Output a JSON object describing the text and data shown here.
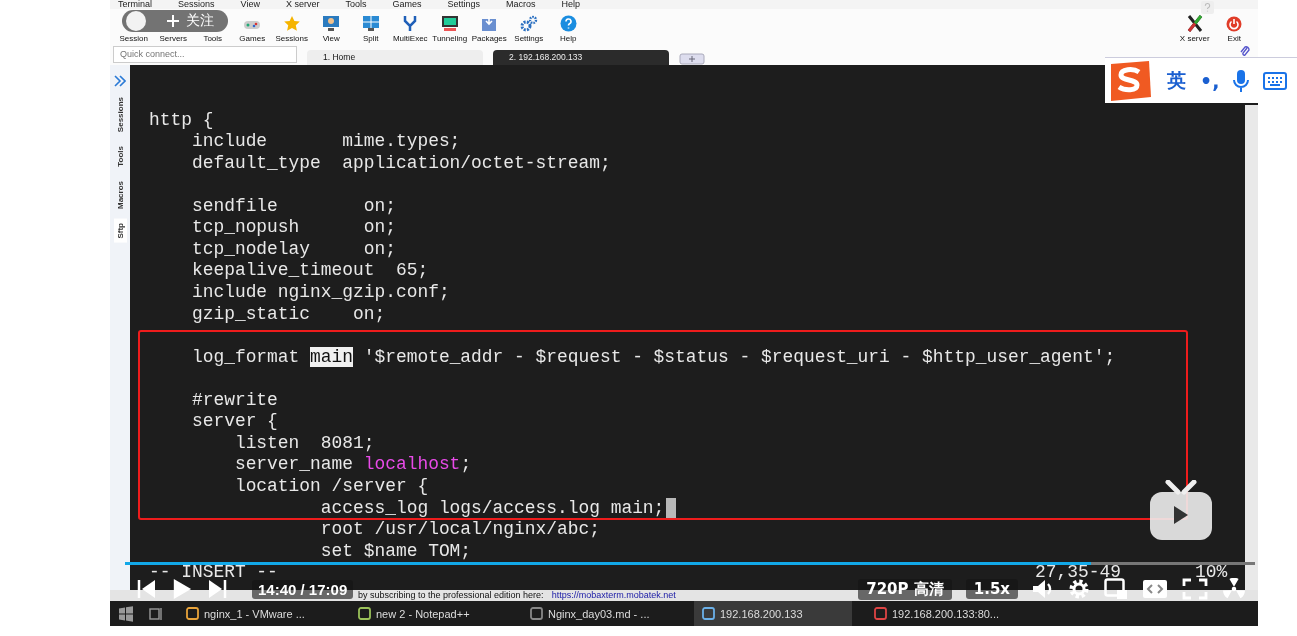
{
  "menu_bar": [
    "Terminal",
    "Sessions",
    "View",
    "X server",
    "Tools",
    "Games",
    "Settings",
    "Macros",
    "Help"
  ],
  "toolbar": [
    {
      "label": "Session"
    },
    {
      "label": "Servers"
    },
    {
      "label": "Tools"
    },
    {
      "label": "Games"
    },
    {
      "label": "Sessions"
    },
    {
      "label": "View"
    },
    {
      "label": "Split"
    },
    {
      "label": "MultiExec"
    },
    {
      "label": "Tunneling"
    },
    {
      "label": "Packages"
    },
    {
      "label": "Settings"
    },
    {
      "label": "Help"
    }
  ],
  "toolbar_right": [
    {
      "label": "X server"
    },
    {
      "label": "Exit"
    }
  ],
  "follow_button": {
    "label": "关注"
  },
  "quick_connect": {
    "placeholder": "Quick connect..."
  },
  "tabs": [
    {
      "label": "1. Home",
      "selected": false
    },
    {
      "label": "2. 192.168.200.133",
      "selected": true
    }
  ],
  "sidebar_tabs": [
    {
      "label": "Sessions",
      "selected": false
    },
    {
      "label": "Tools",
      "selected": false
    },
    {
      "label": "Macros",
      "selected": false
    },
    {
      "label": "Sftp",
      "selected": true
    }
  ],
  "ime_bar": {
    "mode": "英",
    "punctuation": "•,"
  },
  "terminal": {
    "lines": [
      {
        "kind": "code",
        "segments": [
          {
            "kind": "plain",
            "text": "http {"
          }
        ]
      },
      {
        "kind": "code",
        "segments": [
          {
            "kind": "plain",
            "text": "    include       mime.types;"
          }
        ]
      },
      {
        "kind": "code",
        "segments": [
          {
            "kind": "plain",
            "text": "    default_type  application/octet-stream;"
          }
        ]
      },
      {
        "kind": "blank"
      },
      {
        "kind": "code",
        "segments": [
          {
            "kind": "plain",
            "text": "    sendfile        on;"
          }
        ]
      },
      {
        "kind": "code",
        "segments": [
          {
            "kind": "plain",
            "text": "    tcp_nopush      on;"
          }
        ]
      },
      {
        "kind": "code",
        "segments": [
          {
            "kind": "plain",
            "text": "    tcp_nodelay     on;"
          }
        ]
      },
      {
        "kind": "code",
        "segments": [
          {
            "kind": "plain",
            "text": "    keepalive_timeout  65;"
          }
        ]
      },
      {
        "kind": "code",
        "segments": [
          {
            "kind": "plain",
            "text": "    include nginx_gzip.conf;"
          }
        ]
      },
      {
        "kind": "code",
        "segments": [
          {
            "kind": "plain",
            "text": "    gzip_static    on;"
          }
        ]
      },
      {
        "kind": "blank"
      },
      {
        "kind": "code",
        "segments": [
          {
            "kind": "plain",
            "text": "    log_format "
          },
          {
            "kind": "highlight",
            "text": "main"
          },
          {
            "kind": "plain",
            "text": " '$remote_addr - $request - $status - $request_uri - $http_user_agent';"
          }
        ]
      },
      {
        "kind": "blank"
      },
      {
        "kind": "code",
        "segments": [
          {
            "kind": "plain",
            "text": "    #rewrite"
          }
        ]
      },
      {
        "kind": "code",
        "segments": [
          {
            "kind": "plain",
            "text": "    server {"
          }
        ]
      },
      {
        "kind": "code",
        "segments": [
          {
            "kind": "plain",
            "text": "        listen  8081;"
          }
        ]
      },
      {
        "kind": "code",
        "segments": [
          {
            "kind": "plain",
            "text": "        server_name "
          },
          {
            "kind": "value",
            "text": "localhost"
          },
          {
            "kind": "plain",
            "text": ";"
          }
        ]
      },
      {
        "kind": "code",
        "segments": [
          {
            "kind": "plain",
            "text": "        location /server {"
          }
        ]
      },
      {
        "kind": "code",
        "cursor": true,
        "segments": [
          {
            "kind": "plain",
            "text": "                access_log logs/access.log main;"
          }
        ]
      },
      {
        "kind": "code",
        "segments": [
          {
            "kind": "plain",
            "text": "                root /usr/local/nginx/abc;"
          }
        ]
      },
      {
        "kind": "code",
        "segments": [
          {
            "kind": "plain",
            "text": "                set $name TOM;"
          }
        ]
      }
    ],
    "mode": "-- INSERT --",
    "position": "27,35-49",
    "percent": "10%"
  },
  "status_bar": {
    "text": "by subscribing to the professional edition here:",
    "link": "https://mobaxterm.mobatek.net"
  },
  "taskbar": [
    {
      "label": "nginx_1 - VMware ...",
      "selected": false
    },
    {
      "label": "new 2 - Notepad++",
      "selected": false
    },
    {
      "label": "Nginx_day03.md - ...",
      "selected": false
    },
    {
      "label": "192.168.200.133",
      "selected": true
    },
    {
      "label": "192.168.200.133:80...",
      "selected": false
    }
  ],
  "player": {
    "progress": {
      "level": 0.855
    },
    "time": "14:40 / 17:09",
    "quality": "720P 高清",
    "speed": "1.5x"
  }
}
